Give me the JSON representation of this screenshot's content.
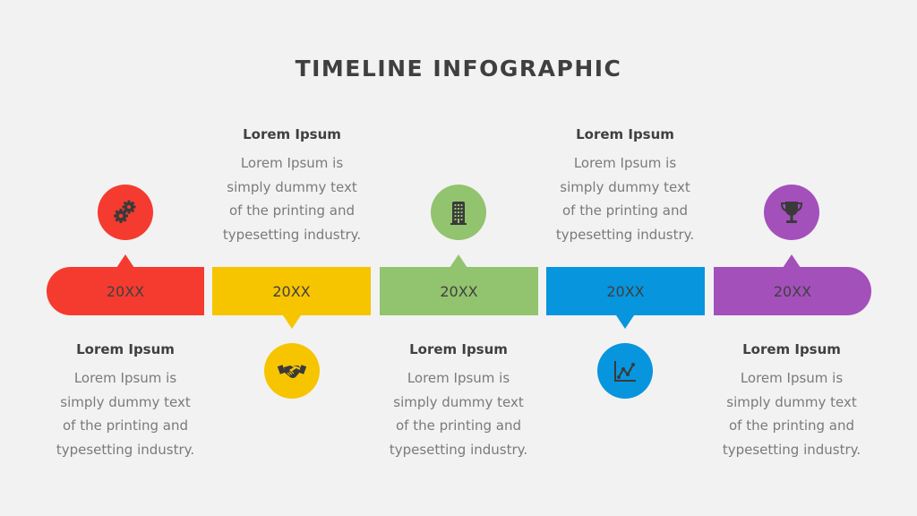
{
  "title": "TIMELINE INFOGRAPHIC",
  "milestones": [
    {
      "year": "20XX",
      "color": "#f53b2f",
      "icon": "gears-icon",
      "icon_position": "top",
      "heading": "Lorem Ipsum",
      "body_lines": [
        "Lorem Ipsum is",
        "simply dummy text",
        "of the printing and",
        "typesetting industry."
      ]
    },
    {
      "year": "20XX",
      "color": "#f7c400",
      "icon": "handshake-icon",
      "icon_position": "bottom",
      "heading": "Lorem Ipsum",
      "body_lines": [
        "Lorem Ipsum is",
        "simply dummy text",
        "of the printing and",
        "typesetting industry."
      ]
    },
    {
      "year": "20XX",
      "color": "#92c36e",
      "icon": "building-icon",
      "icon_position": "top",
      "heading": "Lorem Ipsum",
      "body_lines": [
        "Lorem Ipsum is",
        "simply dummy text",
        "of the printing and",
        "typesetting industry."
      ]
    },
    {
      "year": "20XX",
      "color": "#0795dd",
      "icon": "line-chart-icon",
      "icon_position": "bottom",
      "heading": "Lorem Ipsum",
      "body_lines": [
        "Lorem Ipsum is",
        "simply dummy text",
        "of the printing and",
        "typesetting industry."
      ]
    },
    {
      "year": "20XX",
      "color": "#a350bb",
      "icon": "trophy-icon",
      "icon_position": "top",
      "heading": "Lorem Ipsum",
      "body_lines": [
        "Lorem Ipsum is",
        "simply dummy text",
        "of the printing and",
        "typesetting industry."
      ]
    }
  ]
}
